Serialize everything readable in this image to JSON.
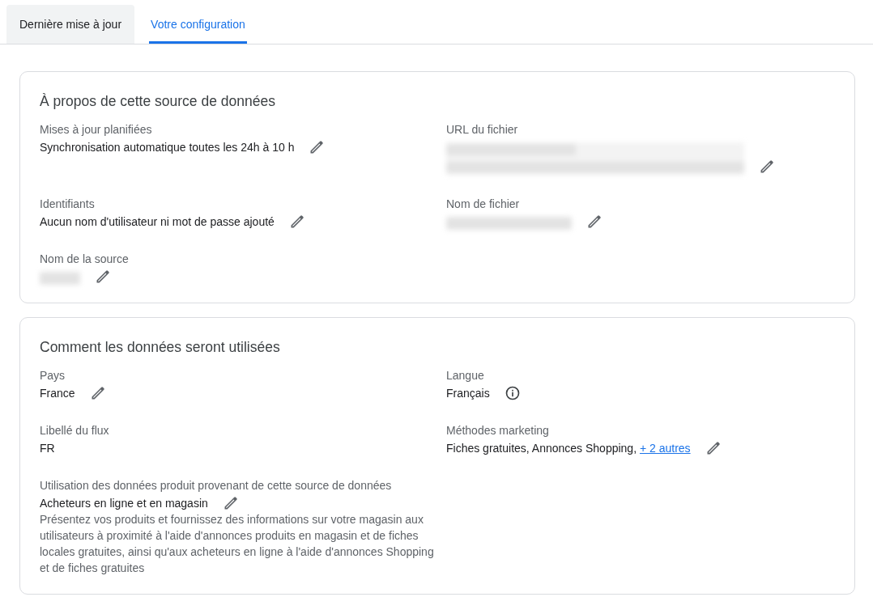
{
  "tabs": [
    {
      "label": "Dernière mise à jour",
      "selected": false
    },
    {
      "label": "Votre configuration",
      "selected": true
    }
  ],
  "cards": [
    {
      "title": "À propos de cette source de données",
      "fields": [
        {
          "label": "Mises à jour planifiées",
          "kind": "text",
          "value": "Synchronisation automatique toutes les 24h à 10 h",
          "icon": {
            "kind": "edit"
          }
        },
        {
          "label": "URL du fichier",
          "kind": "redacted-long",
          "icon": {
            "kind": "edit"
          }
        },
        {
          "label": "Identifiants",
          "kind": "text",
          "value": "Aucun nom d'utilisateur ni mot de passe ajouté",
          "icon": {
            "kind": "edit"
          }
        },
        {
          "label": "Nom de fichier",
          "kind": "redacted-medium",
          "icon": {
            "kind": "edit"
          }
        },
        {
          "label": "Nom de la source",
          "kind": "redacted-short",
          "icon": {
            "kind": "edit"
          }
        }
      ]
    },
    {
      "title": "Comment les données seront utilisées",
      "fields": [
        {
          "label": "Pays",
          "kind": "text",
          "value": "France",
          "icon": {
            "kind": "edit"
          }
        },
        {
          "label": "Langue",
          "kind": "text",
          "value": "Français",
          "icon": {
            "kind": "info"
          }
        },
        {
          "label": "Libellé du flux",
          "kind": "text",
          "value": "FR"
        },
        {
          "label": "Méthodes marketing",
          "kind": "text",
          "value": "Fiches gratuites, Annonces Shopping,",
          "link": "+ 2 autres",
          "icon": {
            "kind": "edit"
          }
        },
        {
          "label": "Utilisation des données produit provenant de cette source de données",
          "kind": "text",
          "value": "Acheteurs en ligne et en magasin",
          "icon": {
            "kind": "edit"
          },
          "description": "Présentez vos produits et fournissez des informations sur votre magasin aux utilisateurs à proximité à l'aide d'annonces produits en magasin et de fiches locales gratuites, ainsi qu'aux acheteurs en ligne à l'aide d'annonces Shopping et de fiches gratuites"
        }
      ]
    }
  ]
}
